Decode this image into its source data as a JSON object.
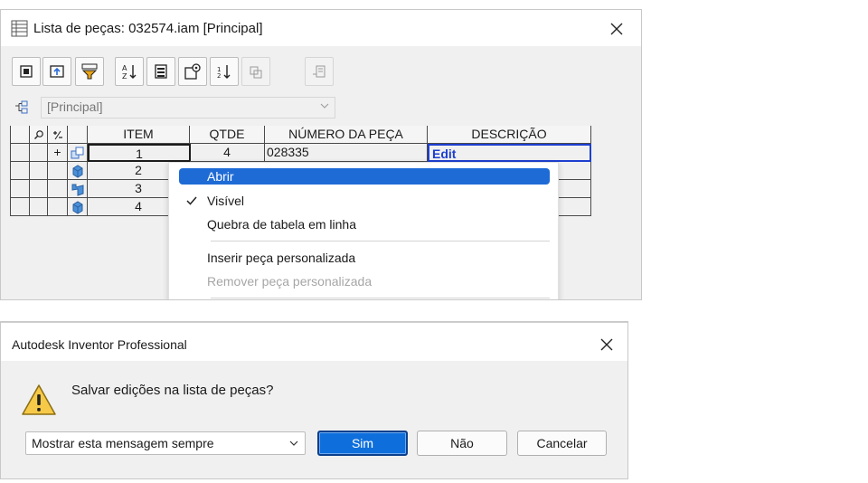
{
  "parts_list": {
    "title": "Lista de peças: 032574.iam [Principal]",
    "view_value": "[Principal]",
    "toolbar": [
      {
        "icon": "filter-icon",
        "enabled": true
      },
      {
        "icon": "export-icon",
        "enabled": true
      },
      {
        "icon": "funnel-icon",
        "enabled": true
      },
      {
        "icon": "sort-az-icon",
        "enabled": true
      },
      {
        "icon": "table-icon",
        "enabled": true
      },
      {
        "icon": "settings-table-icon",
        "enabled": true
      },
      {
        "icon": "renumber-icon",
        "enabled": true
      },
      {
        "icon": "merge-icon",
        "enabled": false
      },
      {
        "icon": "member-icon",
        "enabled": false
      }
    ],
    "columns": [
      "ITEM",
      "QTDE",
      "NÚMERO DA PEÇA",
      "DESCRIÇÃO"
    ],
    "header_icons": [
      "find-icon",
      "expand-icon"
    ],
    "rows": [
      {
        "expand": "+",
        "item": "1",
        "qty": "4",
        "part": "028335",
        "desc": "Edit"
      },
      {
        "expand": "",
        "item": "2",
        "qty": "",
        "part": "",
        "desc": ""
      },
      {
        "expand": "",
        "item": "3",
        "qty": "",
        "part": "",
        "desc": ""
      },
      {
        "expand": "",
        "item": "4",
        "qty": "",
        "part": "",
        "desc": ""
      }
    ],
    "context_menu": {
      "items": [
        {
          "label": "Abrir",
          "highlighted": true,
          "checked": false,
          "disabled": false
        },
        {
          "label": "Visível",
          "highlighted": false,
          "checked": true,
          "disabled": false
        },
        {
          "label": "Quebra de tabela em linha",
          "highlighted": false,
          "checked": false,
          "disabled": false
        },
        {
          "label": "Inserir peça personalizada",
          "highlighted": false,
          "checked": false,
          "disabled": false
        },
        {
          "label": "Remover peça personalizada",
          "highlighted": false,
          "checked": false,
          "disabled": true
        }
      ]
    }
  },
  "dialog": {
    "title": "Autodesk Inventor Professional",
    "message": "Salvar edições na lista de peças?",
    "show_option": "Mostrar esta mensagem sempre",
    "buttons": {
      "yes": "Sim",
      "no": "Não",
      "cancel": "Cancelar"
    }
  },
  "colors": {
    "accent": "#1e6bd6",
    "primary_button": "#0e6fdc",
    "edit_text": "#1d3fd0"
  }
}
